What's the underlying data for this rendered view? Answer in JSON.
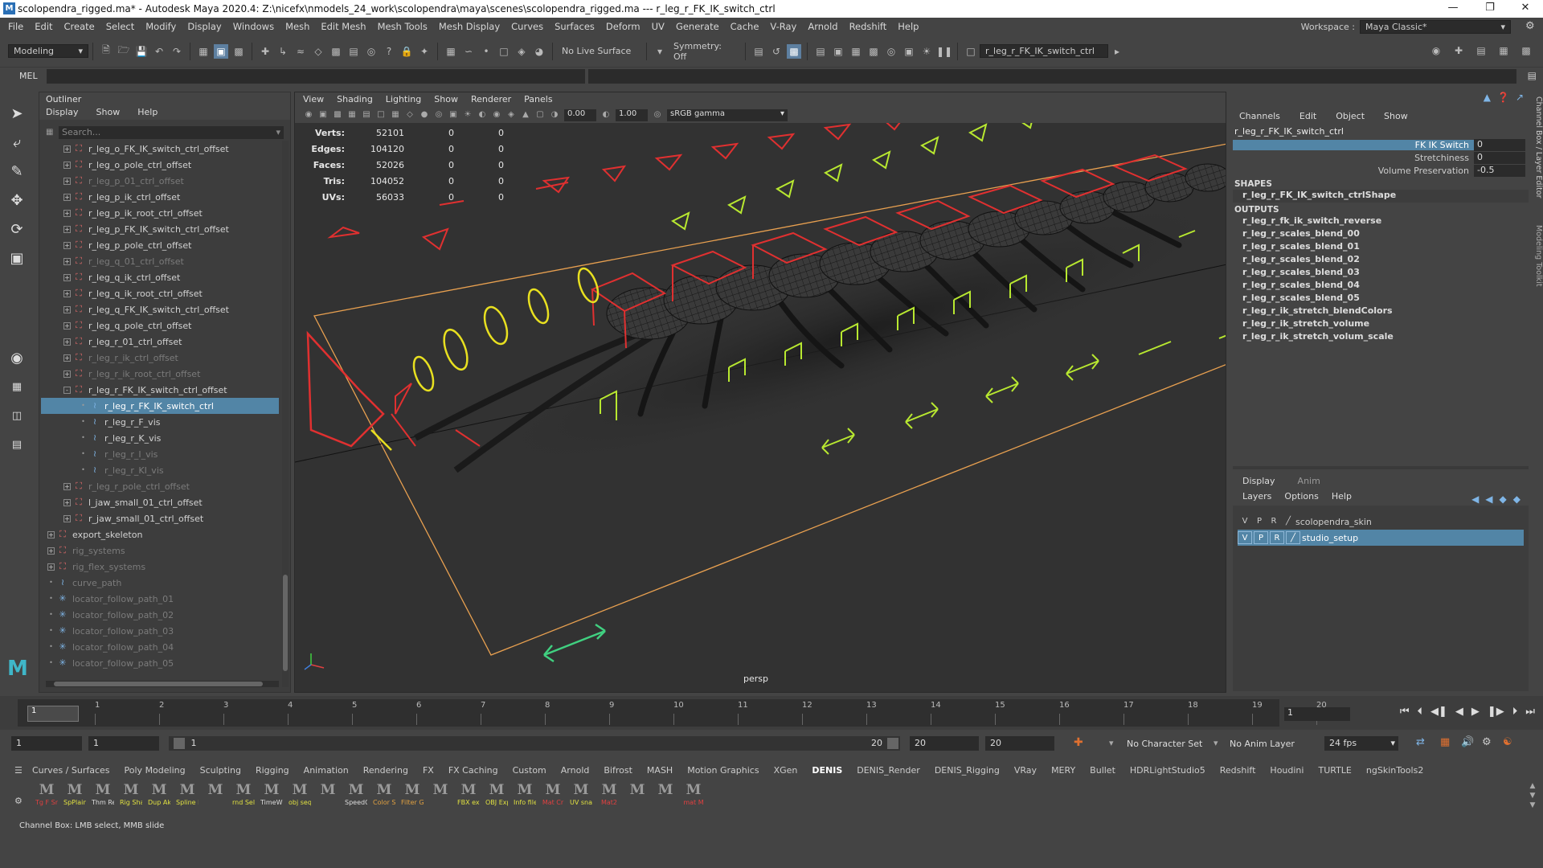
{
  "window": {
    "title": "scolopendra_rigged.ma* - Autodesk Maya 2020.4: Z:\\nicefx\\nmodels_24_work\\scolopendra\\maya\\scenes\\scolopendra_rigged.ma  ---  r_leg_r_FK_IK_switch_ctrl",
    "logo": "M"
  },
  "menubar": {
    "items": [
      "File",
      "Edit",
      "Create",
      "Select",
      "Modify",
      "Display",
      "Windows",
      "Mesh",
      "Edit Mesh",
      "Mesh Tools",
      "Mesh Display",
      "Curves",
      "Surfaces",
      "Deform",
      "UV",
      "Generate",
      "Cache",
      "V-Ray",
      "Arnold",
      "Redshift",
      "Help"
    ],
    "workspace_label": "Workspace :",
    "workspace_value": "Maya Classic*"
  },
  "statusline": {
    "menuset": "Modeling",
    "live_surface": "No Live Surface",
    "symmetry": "Symmetry: Off",
    "selected_field": "r_leg_r_FK_IK_switch_ctrl"
  },
  "mel": {
    "label": "MEL"
  },
  "outliner": {
    "title": "Outliner",
    "menu": [
      "Display",
      "Show",
      "Help"
    ],
    "search_placeholder": "Search...",
    "items": [
      {
        "label": "r_leg_o_FK_IK_switch_ctrl_offset",
        "indent": 2,
        "dim": false,
        "icon": "transform",
        "exp": "+"
      },
      {
        "label": "r_leg_o_pole_ctrl_offset",
        "indent": 2,
        "dim": false,
        "icon": "transform",
        "exp": "+"
      },
      {
        "label": "r_leg_p_01_ctrl_offset",
        "indent": 2,
        "dim": true,
        "icon": "transform",
        "exp": "+"
      },
      {
        "label": "r_leg_p_ik_ctrl_offset",
        "indent": 2,
        "dim": false,
        "icon": "transform",
        "exp": "+"
      },
      {
        "label": "r_leg_p_ik_root_ctrl_offset",
        "indent": 2,
        "dim": false,
        "icon": "transform",
        "exp": "+"
      },
      {
        "label": "r_leg_p_FK_IK_switch_ctrl_offset",
        "indent": 2,
        "dim": false,
        "icon": "transform",
        "exp": "+"
      },
      {
        "label": "r_leg_p_pole_ctrl_offset",
        "indent": 2,
        "dim": false,
        "icon": "transform",
        "exp": "+"
      },
      {
        "label": "r_leg_q_01_ctrl_offset",
        "indent": 2,
        "dim": true,
        "icon": "transform",
        "exp": "+"
      },
      {
        "label": "r_leg_q_ik_ctrl_offset",
        "indent": 2,
        "dim": false,
        "icon": "transform",
        "exp": "+"
      },
      {
        "label": "r_leg_q_ik_root_ctrl_offset",
        "indent": 2,
        "dim": false,
        "icon": "transform",
        "exp": "+"
      },
      {
        "label": "r_leg_q_FK_IK_switch_ctrl_offset",
        "indent": 2,
        "dim": false,
        "icon": "transform",
        "exp": "+"
      },
      {
        "label": "r_leg_q_pole_ctrl_offset",
        "indent": 2,
        "dim": false,
        "icon": "transform",
        "exp": "+"
      },
      {
        "label": "r_leg_r_01_ctrl_offset",
        "indent": 2,
        "dim": false,
        "icon": "transform",
        "exp": "+"
      },
      {
        "label": "r_leg_r_ik_ctrl_offset",
        "indent": 2,
        "dim": true,
        "icon": "transform",
        "exp": "+"
      },
      {
        "label": "r_leg_r_ik_root_ctrl_offset",
        "indent": 2,
        "dim": true,
        "icon": "transform",
        "exp": "+"
      },
      {
        "label": "r_leg_r_FK_IK_switch_ctrl_offset",
        "indent": 2,
        "dim": false,
        "icon": "transform",
        "exp": "-"
      },
      {
        "label": "r_leg_r_FK_IK_switch_ctrl",
        "indent": 3,
        "dim": false,
        "icon": "curve",
        "exp": "",
        "selected": true
      },
      {
        "label": "r_leg_r_F_vis",
        "indent": 3,
        "dim": false,
        "icon": "curve",
        "exp": ""
      },
      {
        "label": "r_leg_r_K_vis",
        "indent": 3,
        "dim": false,
        "icon": "curve",
        "exp": ""
      },
      {
        "label": "r_leg_r_I_vis",
        "indent": 3,
        "dim": true,
        "icon": "curve",
        "exp": ""
      },
      {
        "label": "r_leg_r_KI_vis",
        "indent": 3,
        "dim": true,
        "icon": "curve",
        "exp": ""
      },
      {
        "label": "r_leg_r_pole_ctrl_offset",
        "indent": 2,
        "dim": true,
        "icon": "transform",
        "exp": "+"
      },
      {
        "label": "l_jaw_small_01_ctrl_offset",
        "indent": 2,
        "dim": false,
        "icon": "transform",
        "exp": "+"
      },
      {
        "label": "r_jaw_small_01_ctrl_offset",
        "indent": 2,
        "dim": false,
        "icon": "transform",
        "exp": "+"
      },
      {
        "label": "export_skeleton",
        "indent": 1,
        "dim": false,
        "icon": "transform",
        "exp": "+"
      },
      {
        "label": "rig_systems",
        "indent": 1,
        "dim": true,
        "icon": "transform",
        "exp": "+"
      },
      {
        "label": "rig_flex_systems",
        "indent": 1,
        "dim": true,
        "icon": "transform",
        "exp": "+"
      },
      {
        "label": "curve_path",
        "indent": 1,
        "dim": true,
        "icon": "curve",
        "exp": ""
      },
      {
        "label": "locator_follow_path_01",
        "indent": 1,
        "dim": true,
        "icon": "locator",
        "exp": ""
      },
      {
        "label": "locator_follow_path_02",
        "indent": 1,
        "dim": true,
        "icon": "locator",
        "exp": ""
      },
      {
        "label": "locator_follow_path_03",
        "indent": 1,
        "dim": true,
        "icon": "locator",
        "exp": ""
      },
      {
        "label": "locator_follow_path_04",
        "indent": 1,
        "dim": true,
        "icon": "locator",
        "exp": ""
      },
      {
        "label": "locator_follow_path_05",
        "indent": 1,
        "dim": true,
        "icon": "locator",
        "exp": ""
      }
    ]
  },
  "viewport": {
    "menu": [
      "View",
      "Shading",
      "Lighting",
      "Show",
      "Renderer",
      "Panels"
    ],
    "exposure": "0.00",
    "gamma": "1.00",
    "color_space": "sRGB gamma",
    "camera": "persp",
    "hud": {
      "rows": [
        {
          "key": "Verts:",
          "v": "52101",
          "a": "0",
          "b": "0"
        },
        {
          "key": "Edges:",
          "v": "104120",
          "a": "0",
          "b": "0"
        },
        {
          "key": "Faces:",
          "v": "52026",
          "a": "0",
          "b": "0"
        },
        {
          "key": "Tris:",
          "v": "104052",
          "a": "0",
          "b": "0"
        },
        {
          "key": "UVs:",
          "v": "56033",
          "a": "0",
          "b": "0"
        }
      ]
    }
  },
  "channelbox": {
    "menu": [
      "Channels",
      "Edit",
      "Object",
      "Show"
    ],
    "object": "r_leg_r_FK_IK_switch_ctrl",
    "attributes": [
      {
        "name": "FK IK Switch",
        "value": "0",
        "selected": true
      },
      {
        "name": "Stretchiness",
        "value": "0",
        "selected": false
      },
      {
        "name": "Volume Preservation",
        "value": "-0.5",
        "selected": false
      }
    ],
    "shapes_label": "SHAPES",
    "shapes": [
      "r_leg_r_FK_IK_switch_ctrlShape"
    ],
    "outputs_label": "OUTPUTS",
    "outputs": [
      "r_leg_r_fk_ik_switch_reverse",
      "r_leg_r_scales_blend_00",
      "r_leg_r_scales_blend_01",
      "r_leg_r_scales_blend_02",
      "r_leg_r_scales_blend_03",
      "r_leg_r_scales_blend_04",
      "r_leg_r_scales_blend_05",
      "r_leg_r_ik_stretch_blendColors",
      "r_leg_r_ik_stretch_volume",
      "r_leg_r_ik_stretch_volum_scale"
    ]
  },
  "layereditor": {
    "tabs": [
      "Display",
      "Anim"
    ],
    "menu": [
      "Layers",
      "Options",
      "Help"
    ],
    "layers": [
      {
        "v": "V",
        "p": "P",
        "r": "R",
        "name": "scolopendra_skin",
        "selected": false
      },
      {
        "v": "V",
        "p": "P",
        "r": "R",
        "name": "studio_setup",
        "selected": true
      }
    ]
  },
  "side_tabs": [
    "Channel Box / Layer Editor",
    "Modeling Toolkit"
  ],
  "timeline": {
    "ticks": [
      "1",
      "2",
      "3",
      "4",
      "5",
      "6",
      "7",
      "8",
      "9",
      "10",
      "11",
      "12",
      "13",
      "14",
      "15",
      "16",
      "17",
      "18",
      "19",
      "20"
    ],
    "current_frame": "1",
    "current_field": "1"
  },
  "rangebar": {
    "start": "1",
    "start2": "1",
    "slider_start": "1",
    "slider_end": "20",
    "end": "20",
    "end2": "20",
    "character_set": "No Character Set",
    "anim_layer": "No Anim Layer",
    "fps": "24 fps"
  },
  "shelf": {
    "tabs": [
      "Curves / Surfaces",
      "Poly Modeling",
      "Sculpting",
      "Rigging",
      "Animation",
      "Rendering",
      "FX",
      "FX Caching",
      "Custom",
      "Arnold",
      "Bifrost",
      "MASH",
      "Motion Graphics",
      "XGen",
      "DENIS",
      "DENIS_Render",
      "DENIS_Rigging",
      "VRay",
      "MERY",
      "Bullet",
      "HDRLightStudio5",
      "Redshift",
      "Houdini",
      "TURTLE",
      "ngSkinTools2"
    ],
    "active_tab": "DENIS",
    "icons": [
      {
        "label": "Tg F Sn",
        "color": "#e04040"
      },
      {
        "label": "SpPlain",
        "color": "#e0e040"
      },
      {
        "label": "Thm Re",
        "color": "#dddddd"
      },
      {
        "label": "Rig Sha",
        "color": "#e0e040"
      },
      {
        "label": "Dup Ak",
        "color": "#e0e040"
      },
      {
        "label": "Spline I",
        "color": "#e0e040"
      },
      {
        "label": "",
        "color": "#dddddd"
      },
      {
        "label": "rnd Sel",
        "color": "#e0e040"
      },
      {
        "label": "TimeWi",
        "color": "#dddddd"
      },
      {
        "label": "obj seq",
        "color": "#e0e040"
      },
      {
        "label": "",
        "color": "#dddddd"
      },
      {
        "label": "SpeedC",
        "color": "#dddddd"
      },
      {
        "label": "Color S",
        "color": "#e0a040"
      },
      {
        "label": "Filter G",
        "color": "#e0a040"
      },
      {
        "label": "",
        "color": "#dddddd"
      },
      {
        "label": "FBX exp",
        "color": "#e0e040"
      },
      {
        "label": "OBJ Exp",
        "color": "#e0e040"
      },
      {
        "label": "Info file",
        "color": "#e0e040"
      },
      {
        "label": "Mat Cr",
        "color": "#e04040"
      },
      {
        "label": "UV snap",
        "color": "#e0e040"
      },
      {
        "label": "Mat2",
        "color": "#e04040"
      },
      {
        "label": "",
        "color": "#e04040"
      },
      {
        "label": "",
        "color": "#dddddd"
      },
      {
        "label": "mat M",
        "color": "#e04040"
      }
    ]
  },
  "helpline": {
    "text": "Channel Box: LMB select, MMB slide"
  },
  "colors": {
    "selection": "#5285a6",
    "ctrl_red": "#e03030",
    "ctrl_yellow": "#c8e830",
    "ctrl_green": "#40d080",
    "grid_orange": "#f0a040"
  }
}
